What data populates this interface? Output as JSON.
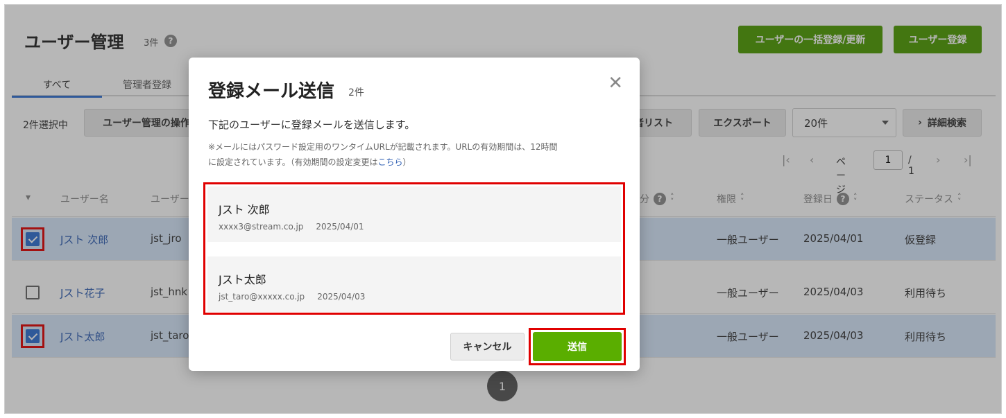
{
  "header": {
    "title": "ユーザー管理",
    "count": "3件",
    "help": "?",
    "bulk_button": "ユーザーの一括登録/更新",
    "register_button": "ユーザー登録"
  },
  "tabs": [
    {
      "label": "すべて"
    },
    {
      "label": "管理者登録"
    }
  ],
  "toolbar": {
    "selected_count": "2件選択中",
    "ops_button": "ユーザー管理の操作",
    "list_button": "者リスト",
    "export_button": "エクスポート",
    "per_page": "20件",
    "advanced_search": "詳細検索"
  },
  "pager": {
    "page_label": "ページ",
    "current": "1",
    "total": "/ 1",
    "bottom_page": "1"
  },
  "table": {
    "headers": {
      "user_name": "ユーザー名",
      "user_id": "ユーザー",
      "category": "分",
      "role": "権限",
      "registered": "登録日",
      "status": "ステータス"
    },
    "rows": [
      {
        "name": "Jスト 次郎",
        "id": "jst_jro",
        "role": "一般ユーザー",
        "date": "2025/04/01",
        "status": "仮登録",
        "checked": true
      },
      {
        "name": "Jスト花子",
        "id": "jst_hnk",
        "role": "一般ユーザー",
        "date": "2025/04/03",
        "status": "利用待ち",
        "checked": false
      },
      {
        "name": "Jスト太郎",
        "id": "jst_taro",
        "role": "一般ユーザー",
        "date": "2025/04/03",
        "status": "利用待ち",
        "checked": true
      }
    ]
  },
  "modal": {
    "title": "登録メール送信",
    "count": "2件",
    "description": "下記のユーザーに登録メールを送信します。",
    "note_line1": "※メールにはパスワード設定用のワンタイムURLが記載されます。URLの有効期間は、12時間",
    "note_line2": "に設定されています。（有効期間の設定変更は",
    "note_link": "こちら",
    "note_tail": "）",
    "users": [
      {
        "name": "Jスト 次郎",
        "email": "xxxx3@stream.co.jp",
        "date": "2025/04/01"
      },
      {
        "name": "Jスト太郎",
        "email": "jst_taro@xxxxx.co.jp",
        "date": "2025/04/03"
      }
    ],
    "cancel": "キャンセル",
    "send": "送信"
  },
  "colors": {
    "accent_green": "#4e9b00",
    "highlight_red": "#e00000",
    "selected_row": "#d6e6fb",
    "link_blue": "#2f5fb3"
  }
}
